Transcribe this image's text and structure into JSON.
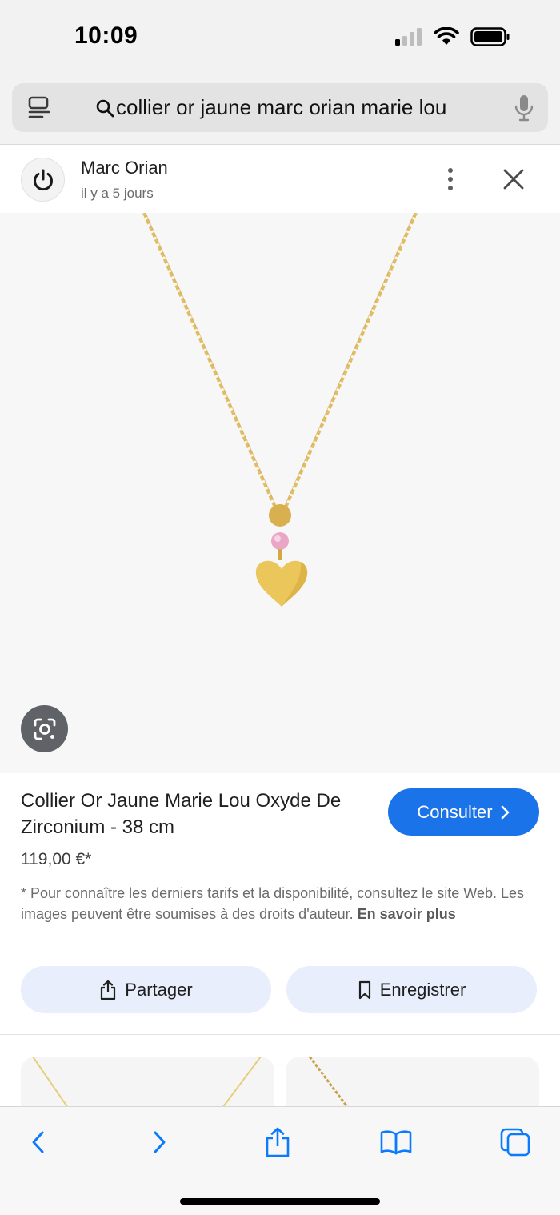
{
  "status_bar": {
    "time": "10:09"
  },
  "address_bar": {
    "query": "collier or jaune marc orian marie lou"
  },
  "source": {
    "name": "Marc Orian",
    "time_ago": "il y a 5 jours"
  },
  "product": {
    "title": "Collier Or Jaune Marie Lou Oxyde De Zirconium - 38 cm",
    "price": "119,00 €*",
    "visit_label": "Consulter",
    "disclaimer_text": "* Pour connaître les derniers tarifs et la disponibilité, consultez le site Web. Les images peuvent être soumises à des droits d'auteur. ",
    "learn_more_label": "En savoir plus"
  },
  "actions": {
    "share_label": "Partager",
    "save_label": "Enregistrer"
  },
  "icons": {
    "reader": "reader-mode-icon",
    "search": "search-icon",
    "mic": "microphone-icon",
    "source_logo": "power-icon",
    "more": "more-vertical-icon",
    "close": "close-icon",
    "lens": "google-lens-icon",
    "share": "share-icon",
    "bookmark": "bookmark-icon",
    "back": "chevron-left-icon",
    "forward": "chevron-right-icon",
    "toolbar_share": "share-icon",
    "bookmarks": "open-book-icon",
    "tabs": "tabs-icon"
  },
  "colors": {
    "accent": "#1a73e8",
    "ios_blue": "#0a7aff",
    "action_button_bg": "#e8eefb",
    "gold": "#e8c25a",
    "stone": "#e9a6c6"
  }
}
